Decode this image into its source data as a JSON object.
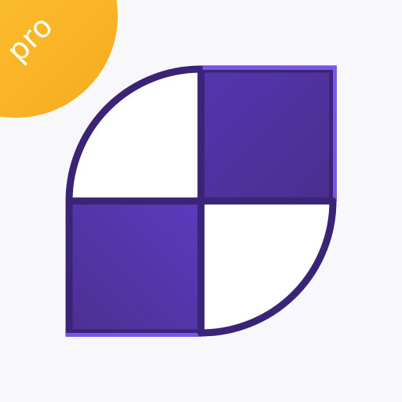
{
  "app_icon": {
    "badge_label": "pro",
    "colors": {
      "background": "#f8f8fa",
      "badge": "#f7b024",
      "badge_text": "#ffffff",
      "tile_dark": "#4a2f8e",
      "tile_light": "#5c3dbf",
      "outline": "#3b2377",
      "quadrant_fill": "#ffffff"
    }
  }
}
